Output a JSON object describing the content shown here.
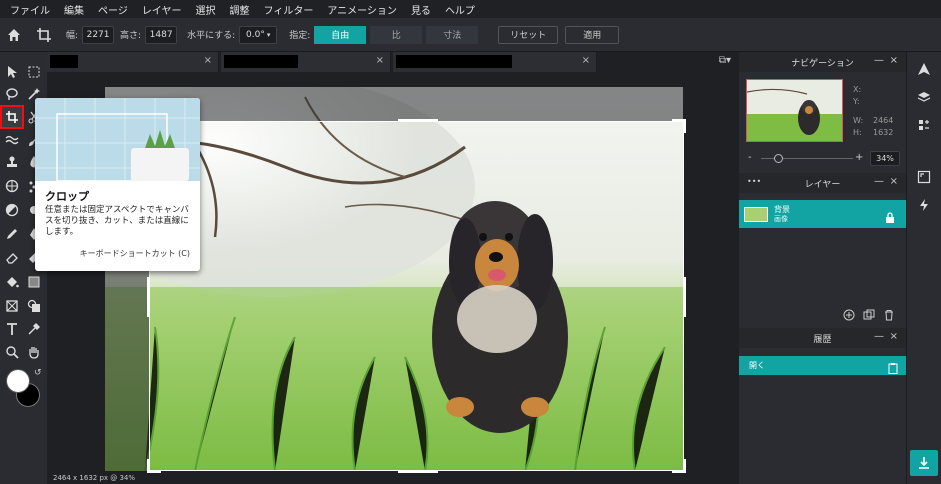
{
  "menu": [
    "ファイル",
    "編集",
    "ページ",
    "レイヤー",
    "選択",
    "調整",
    "フィルター",
    "アニメーション",
    "見る",
    "ヘルプ"
  ],
  "options": {
    "width_label": "幅:",
    "width_value": "2271",
    "height_label": "高さ:",
    "height_value": "1487",
    "straighten_label": "水平にする:",
    "straighten_value": "0.0°",
    "mode_label": "指定:",
    "modes": [
      "自由",
      "比",
      "寸法"
    ],
    "active_mode": "自由",
    "reset_label": "リセット",
    "apply_label": "適用"
  },
  "tabs": [
    {
      "name": "",
      "close": "×"
    },
    {
      "name": "",
      "close": "×"
    },
    {
      "name": "",
      "close": "×"
    }
  ],
  "status_bar": "2464 x 1632 px @ 34%",
  "tooltip": {
    "title": "クロップ",
    "description": "任意または固定アスペクトでキャンバスを切り抜き、カット、または直線にします。",
    "shortcut": "キーボードショートカット (C)"
  },
  "navigation": {
    "title": "ナビゲーション",
    "x_label": "X:",
    "y_label": "Y:",
    "w_label": "W:",
    "w_value": "2464",
    "h_label": "H:",
    "h_value": "1632",
    "zoom_minus": "-",
    "zoom_plus": "+",
    "zoom_value": "34%",
    "zoom_level": 0.18
  },
  "layers": {
    "title": "レイヤー",
    "more": "•••",
    "items": [
      {
        "name": "背景",
        "type": "画像"
      }
    ]
  },
  "history": {
    "title": "履歴",
    "items": [
      {
        "label": "開く"
      }
    ]
  },
  "panel_controls": {
    "minimize": "—",
    "close": "×"
  },
  "colors": {
    "accent": "#12a3a3",
    "foreground": "#ffffff",
    "background": "#000000",
    "selected_tool_outline": "#ee1111"
  }
}
